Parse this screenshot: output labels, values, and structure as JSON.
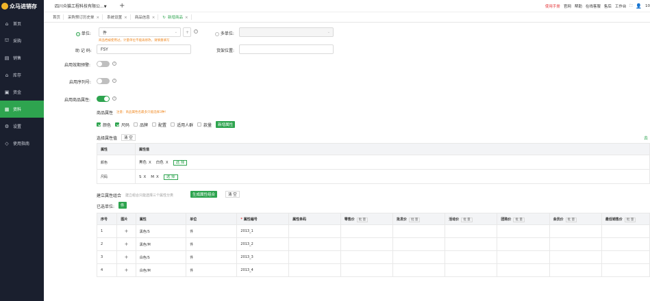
{
  "app": {
    "logo_text": "众马进销存"
  },
  "sidebar": {
    "items": [
      {
        "label": "首页",
        "icon": "home-icon",
        "glyph": "⌂"
      },
      {
        "label": "采购",
        "icon": "purchase-icon",
        "glyph": "⛫"
      },
      {
        "label": "销售",
        "icon": "sales-icon",
        "glyph": "▤"
      },
      {
        "label": "库存",
        "icon": "warehouse-icon",
        "glyph": "⌂"
      },
      {
        "label": "资金",
        "icon": "money-icon",
        "glyph": "▣"
      },
      {
        "label": "资料",
        "icon": "data-icon",
        "glyph": "▦"
      },
      {
        "label": "设置",
        "icon": "gear-icon",
        "glyph": "⚙"
      },
      {
        "label": "使用指南",
        "icon": "guide-icon",
        "glyph": "◇"
      }
    ],
    "active_index": 5
  },
  "topbar": {
    "company": "四川众猫工程科技有限公...",
    "plus": "+",
    "links": [
      "使用手册",
      "官网",
      "帮助",
      "在线客服",
      "售后",
      "工作台"
    ],
    "fullscreen_glyph": "⛶",
    "user_glyph": "👤",
    "user": "10"
  },
  "tabs": [
    {
      "label": "首页",
      "closable": false
    },
    {
      "label": "采购预订历史单",
      "closable": true
    },
    {
      "label": "系统设置",
      "closable": true
    },
    {
      "label": "商品信息",
      "closable": true
    },
    {
      "label": "新增商品",
      "closable": true,
      "active": true,
      "refresh": "↻"
    }
  ],
  "form": {
    "unit_label": "单位:",
    "unit_value": "件",
    "multi_unit_label": "多单位:",
    "unit_hint": "商品档被使用过，计量单位不能再修改，请慎重填写",
    "mnemonic_label": "助 记 码:",
    "mnemonic_value": "FSY",
    "shelf_label": "货架位置:",
    "shelf_value": "",
    "expiry_label": "启用效期预警:",
    "serial_label": "启用序列号:",
    "attr_enable_label": "启用商品属性:"
  },
  "attributes": {
    "title": "商品属性",
    "note": "注意：商品属性名最多只能选择3种!",
    "options": [
      {
        "label": "颜色",
        "checked": true
      },
      {
        "label": "尺码",
        "checked": true
      },
      {
        "label": "品牌",
        "checked": false
      },
      {
        "label": "配置",
        "checked": false
      },
      {
        "label": "适用人群",
        "checked": false
      },
      {
        "label": "款量",
        "checked": false
      }
    ],
    "add_button": "新增属性",
    "select_values_label": "选择属性值",
    "clear_button": "清 空",
    "right_link": "去",
    "table_headers": [
      "属性",
      "属性值"
    ],
    "rows": [
      {
        "name": "颜色",
        "values": [
          "黑色",
          "白色"
        ],
        "select": "选 择"
      },
      {
        "name": "尺码",
        "values": [
          "S",
          "M"
        ],
        "select": "选 择"
      }
    ]
  },
  "combo": {
    "label": "建立属性组合",
    "hint": "建立组合只能选择三个属性分类",
    "generate_button": "生成属性组合",
    "clear_button": "清 空",
    "selected_unit_label": "已选单位:",
    "selected_unit_value": "件",
    "headers": [
      "序号",
      "图片",
      "属性",
      "单位",
      "属性编号",
      "属性条码",
      "零售价",
      "批发价",
      "活动价",
      "团购价",
      "会员价",
      "最低销售价"
    ],
    "batch_label": "批 量",
    "rows": [
      {
        "no": "1",
        "img": "+",
        "attr": "黑色/S",
        "unit": "件",
        "code": "2013_1"
      },
      {
        "no": "2",
        "img": "+",
        "attr": "黑色/M",
        "unit": "件",
        "code": "2013_2"
      },
      {
        "no": "3",
        "img": "+",
        "attr": "白色/S",
        "unit": "件",
        "code": "2013_3"
      },
      {
        "no": "4",
        "img": "+",
        "attr": "白色/M",
        "unit": "件",
        "code": "2013_4"
      }
    ]
  }
}
